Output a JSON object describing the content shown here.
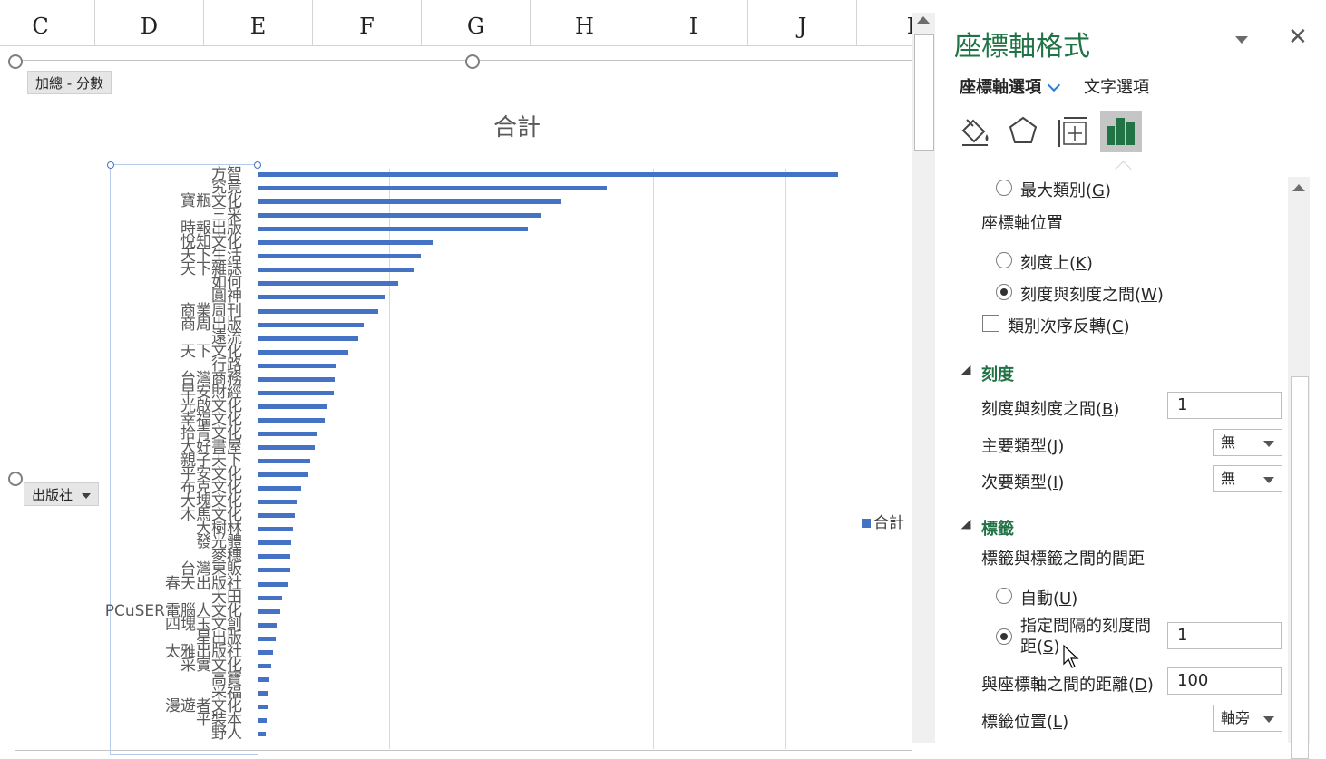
{
  "sheet": {
    "columns": [
      "C",
      "D",
      "E",
      "F",
      "G",
      "H",
      "I",
      "J",
      "I"
    ]
  },
  "chart": {
    "field_value": "加總 - 分數",
    "field_row": "出版社",
    "legend_label": "合計"
  },
  "chart_data": {
    "type": "bar",
    "title": "合計",
    "orientation": "horizontal",
    "categories": [
      "方智",
      "究竟",
      "寶瓶文化",
      "三采",
      "時報出版",
      "悅知文化",
      "天下生活",
      "天下雜誌",
      "如何",
      "圓神",
      "商業周刊",
      "商周出版",
      "遠流",
      "天下文化",
      "行路",
      "台灣商務",
      "早安財經",
      "光啟文化",
      "幸福文化",
      "拾青文化",
      "大好書屋",
      "親子天下",
      "平安文化",
      "布克文化",
      "大塊文化",
      "木馬文化",
      "大樹林",
      "發光體",
      "麥穗",
      "台灣東販",
      "春天出版社",
      "大田",
      "PCuSER電腦人文化",
      "四塊玉文創",
      "星出版",
      "太雅出版社",
      "采實文化",
      "高寶",
      "采福",
      "漫遊者文化",
      "平裝本",
      "野人"
    ],
    "values": [
      88,
      53,
      46,
      43,
      41,
      26.5,
      24.7,
      23.8,
      21.3,
      19.3,
      18.3,
      16.1,
      15.3,
      13.8,
      11.9,
      11.7,
      11.5,
      10.5,
      10.2,
      8.9,
      8.6,
      8,
      7.7,
      6.6,
      5.9,
      5.6,
      5.3,
      5.1,
      4.9,
      4.9,
      4.6,
      3.7,
      3.4,
      2.9,
      2.8,
      2.4,
      2,
      1.8,
      1.6,
      1.5,
      1.4,
      1.3
    ],
    "xlim": [
      0,
      100
    ],
    "grid": true,
    "legend": "right",
    "series": [
      {
        "name": "合計",
        "color": "#4472c4"
      }
    ]
  },
  "pane": {
    "title": "座標軸格式",
    "tab_axis": "座標軸選項",
    "tab_text": "文字選項",
    "max_category": "最大類別(",
    "max_category_key": "G",
    "axis_position": "座標軸位置",
    "on_tick": "刻度上(",
    "on_tick_key": "K",
    "between_ticks": "刻度與刻度之間(",
    "between_ticks_key": "W",
    "reverse_order": "類別次序反轉(",
    "reverse_order_key": "C",
    "ticks_title": "刻度",
    "interval_label": "刻度與刻度之間(",
    "interval_key": "B",
    "interval_value": "1",
    "major_type_label": "主要類型(",
    "major_type_key": "J",
    "major_type_value": "無",
    "minor_type_label": "次要類型(",
    "minor_type_key": "I",
    "minor_type_value": "無",
    "labels_title": "標籤",
    "label_interval_title": "標籤與標籤之間的間距",
    "auto": "自動(",
    "auto_key": "U",
    "specify_line1": "指定間隔的刻度間",
    "specify_line2": "距(",
    "specify_key": "S",
    "specify_value": "1",
    "distance_label": "與座標軸之間的距離(",
    "distance_key": "D",
    "distance_value": "100",
    "label_position_label": "標籤位置(",
    "label_position_key": "L",
    "label_position_value": "軸旁",
    "close_paren": ")"
  }
}
